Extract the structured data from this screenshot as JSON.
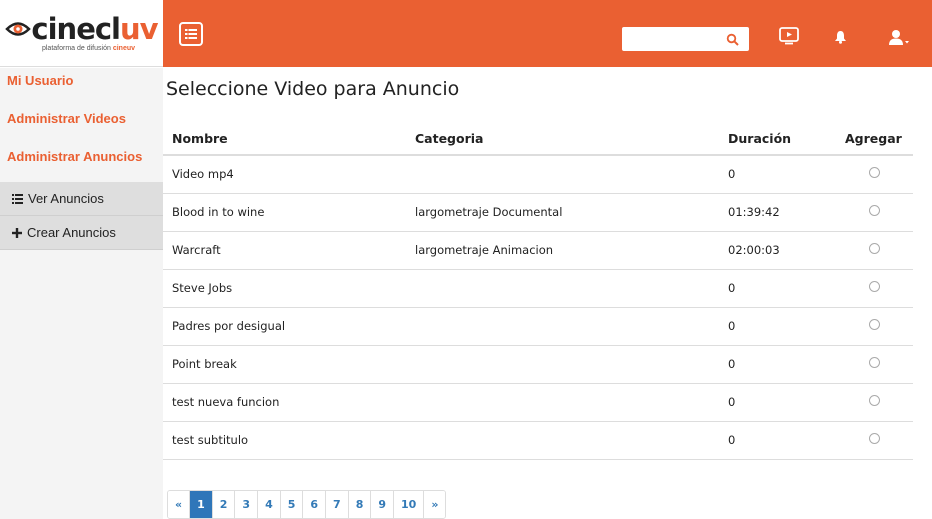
{
  "brand": {
    "name_dark": "cinecl",
    "name_accent": "uv",
    "tagline": "plataforma de difusión",
    "tagline_brand": "cineuv"
  },
  "colors": {
    "accent": "#ea6032",
    "link": "#337ab7",
    "active_page": "#2f76b9"
  },
  "header": {
    "search_placeholder": "",
    "icons": [
      "menu-icon",
      "search-icon",
      "tv-icon",
      "bell-icon",
      "user-icon"
    ]
  },
  "sidebar": {
    "links": [
      "Mi Usuario",
      "Administrar Videos",
      "Administrar Anuncios"
    ],
    "subitems": [
      {
        "icon": "list-icon",
        "label": "Ver Anuncios"
      },
      {
        "icon": "plus-icon",
        "label": "Crear Anuncios"
      }
    ]
  },
  "main": {
    "title": "Seleccione Video para Anuncio",
    "columns": [
      "Nombre",
      "Categoria",
      "Duración",
      "Agregar"
    ],
    "rows": [
      {
        "name": "Video mp4",
        "category": "",
        "duration": "0"
      },
      {
        "name": "Blood in to wine",
        "category": "largometraje Documental",
        "duration": "01:39:42"
      },
      {
        "name": "Warcraft",
        "category": "largometraje Animacion",
        "duration": "02:00:03"
      },
      {
        "name": "Steve Jobs",
        "category": "",
        "duration": "0"
      },
      {
        "name": "Padres por desigual",
        "category": "",
        "duration": "0"
      },
      {
        "name": "Point break",
        "category": "",
        "duration": "0"
      },
      {
        "name": "test nueva funcion",
        "category": "",
        "duration": "0"
      },
      {
        "name": "test subtitulo",
        "category": "",
        "duration": "0"
      }
    ],
    "pagination": {
      "prev": "«",
      "pages": [
        "1",
        "2",
        "3",
        "4",
        "5",
        "6",
        "7",
        "8",
        "9",
        "10"
      ],
      "next": "»",
      "active": "1"
    }
  }
}
